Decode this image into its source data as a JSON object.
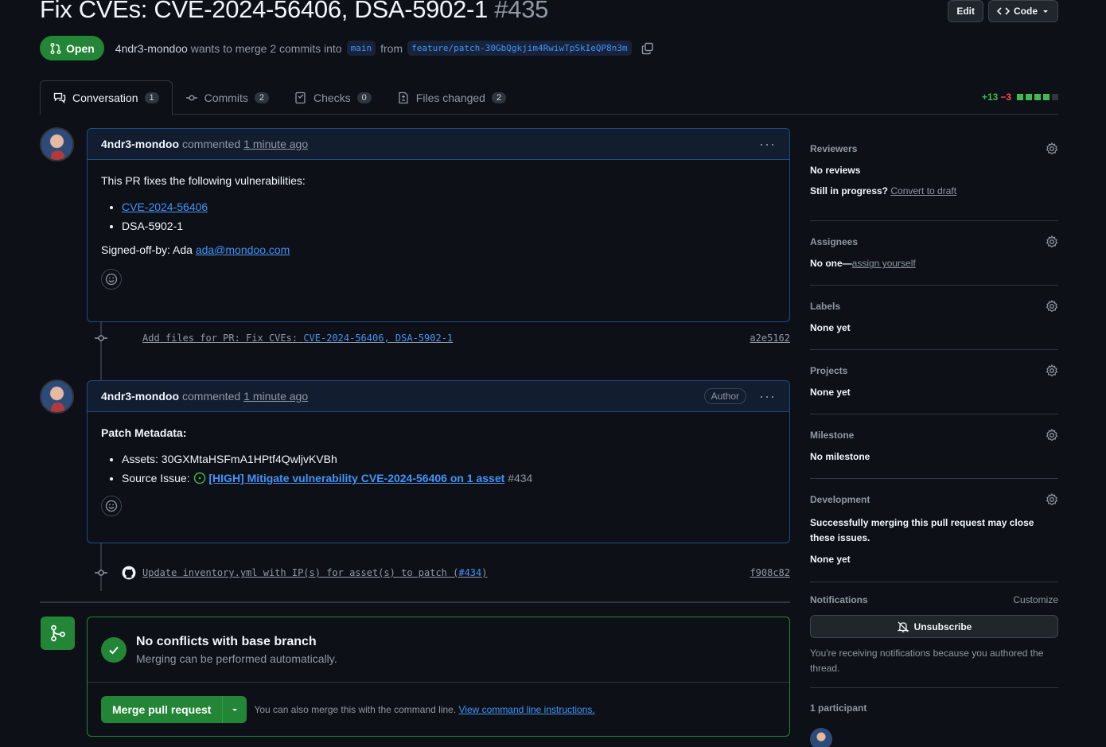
{
  "header": {
    "title": "Fix CVEs: CVE-2024-56406, DSA-5902-1",
    "number": "#435",
    "edit_label": "Edit",
    "code_label": "Code"
  },
  "meta": {
    "state": "Open",
    "author": "4ndr3-mondoo",
    "text_merge": "wants to merge 2 commits into",
    "base_branch": "main",
    "text_from": "from",
    "head_branch": "feature/patch-30GbQgkjim4RwiwTpSkIeQP8n3m"
  },
  "tabs": [
    {
      "label": "Conversation",
      "count": "1"
    },
    {
      "label": "Commits",
      "count": "2"
    },
    {
      "label": "Checks",
      "count": "0"
    },
    {
      "label": "Files changed",
      "count": "2"
    }
  ],
  "diffstat": {
    "additions": "+13",
    "deletions": "−3"
  },
  "comment1": {
    "author": "4ndr3-mondoo",
    "action": "commented",
    "ago": "1 minute ago",
    "intro": "This PR fixes the following vulnerabilities:",
    "item1": "CVE-2024-56406",
    "item2": "DSA-5902-1",
    "signoff_prefix": "Signed-off-by: Ada",
    "signoff_email": "ada@mondoo.com"
  },
  "commit1": {
    "message_prefix": "Add files for PR: Fix CVEs:",
    "message_link": "CVE-2024-56406, DSA-5902-1",
    "sha": "a2e5162"
  },
  "comment2": {
    "author": "4ndr3-mondoo",
    "action": "commented",
    "ago": "1 minute ago",
    "badge": "Author",
    "heading": "Patch Metadata:",
    "assets": "Assets: 30GXMtaHSFmA1HPtf4QwljvKVBh",
    "source_label": "Source Issue:",
    "source_link": "[HIGH] Mitigate vulnerability CVE-2024-56406 on 1 asset",
    "source_num": "#434"
  },
  "commit2": {
    "message_prefix": "Update inventory.yml with IP(s) for asset(s) to patch (",
    "message_link": "#434",
    "message_suffix": ")",
    "sha": "f908c82"
  },
  "merge": {
    "title": "No conflicts with base branch",
    "subtitle": "Merging can be performed automatically.",
    "button": "Merge pull request",
    "hint": "You can also merge this with the command line.",
    "hint_link": "View command line instructions."
  },
  "sidebar": {
    "reviewers": {
      "title": "Reviewers",
      "value": "No reviews",
      "progress": "Still in progress?",
      "link": "Convert to draft"
    },
    "assignees": {
      "title": "Assignees",
      "value": "No one—",
      "link": "assign yourself"
    },
    "labels": {
      "title": "Labels",
      "value": "None yet"
    },
    "projects": {
      "title": "Projects",
      "value": "None yet"
    },
    "milestone": {
      "title": "Milestone",
      "value": "No milestone"
    },
    "development": {
      "title": "Development",
      "desc": "Successfully merging this pull request may close these issues.",
      "value": "None yet"
    },
    "notifications": {
      "title": "Notifications",
      "customize": "Customize",
      "button": "Unsubscribe",
      "note": "You're receiving notifications because you authored the thread."
    },
    "participants": {
      "title": "1 participant"
    }
  }
}
